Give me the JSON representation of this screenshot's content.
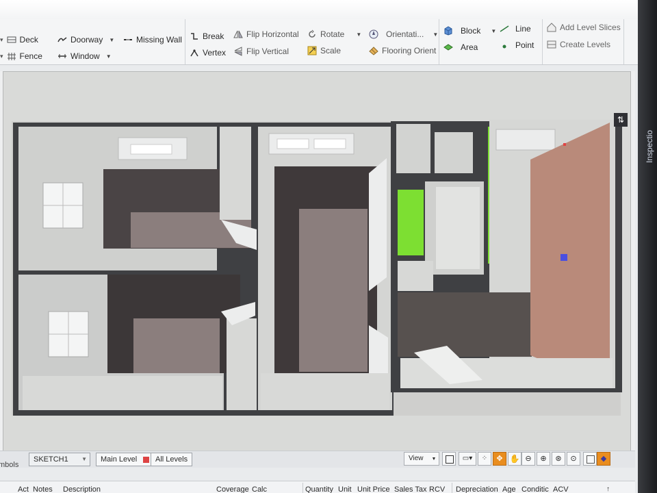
{
  "ribbon": {
    "deck": "Deck",
    "fence": "Fence",
    "doorway": "Doorway",
    "window": "Window",
    "missing_wall": "Missing Wall",
    "break": "Break",
    "vertex": "Vertex",
    "flip_horizontal": "Flip Horizontal",
    "flip_vertical": "Flip Vertical",
    "rotate": "Rotate",
    "scale": "Scale",
    "orientation": "Orientati...",
    "flooring_orient": "Flooring Orient",
    "block": "Block",
    "area": "Area",
    "line": "Line",
    "point": "Point",
    "add_level_slices": "Add Level Slices",
    "create_levels": "Create Levels"
  },
  "sidebar_fragment": "mbols",
  "bezel_text": "Inspectio",
  "tabs": {
    "sketch_name": "SKETCH1",
    "main_level": "Main Level",
    "all_levels": "All Levels",
    "view": "View"
  },
  "grid_columns": {
    "act": "Act",
    "notes": "Notes",
    "description": "Description",
    "coverage": "Coverage",
    "calc": "Calc",
    "quantity": "Quantity",
    "unit": "Unit",
    "unit_price": "Unit Price",
    "sales_tax": "Sales Tax",
    "rcv": "RCV",
    "depreciation": "Depreciation",
    "age": "Age",
    "condition": "Conditic",
    "acv": "ACV"
  },
  "colors": {
    "floor_dark": "#4a4445",
    "floor_room": "#8b7e7d",
    "wall": "#3f4043",
    "highlight_green": "#7ddf32",
    "accent_wall": "#b98a7a",
    "selected_orange": "#e98d1f"
  }
}
